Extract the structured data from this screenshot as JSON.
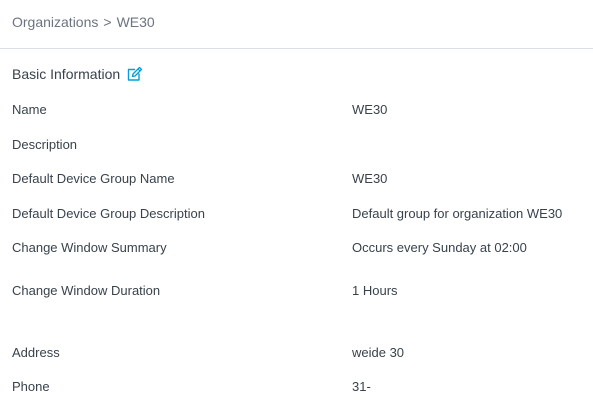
{
  "breadcrumb": {
    "parent": "Organizations",
    "separator": ">",
    "current": "WE30"
  },
  "section": {
    "title": "Basic Information",
    "edit_icon": "edit-icon"
  },
  "fields": {
    "name": {
      "label": "Name",
      "value": "WE30"
    },
    "description": {
      "label": "Description",
      "value": ""
    },
    "device_group_name": {
      "label": "Default Device Group Name",
      "value": "WE30"
    },
    "device_group_description": {
      "label": "Default Device Group Description",
      "value": "Default group for organization WE30"
    },
    "change_window_summary": {
      "label": "Change Window Summary",
      "value": "Occurs every Sunday at 02:00"
    },
    "change_window_duration": {
      "label": "Change Window Duration",
      "value": "1 Hours"
    },
    "address": {
      "label": "Address",
      "value": "weide 30"
    },
    "phone": {
      "label": "Phone",
      "value": "31-"
    }
  },
  "colors": {
    "text": "#39424c",
    "muted": "#6b7480",
    "accent": "#049fd9",
    "divider": "#dcdfe3"
  }
}
